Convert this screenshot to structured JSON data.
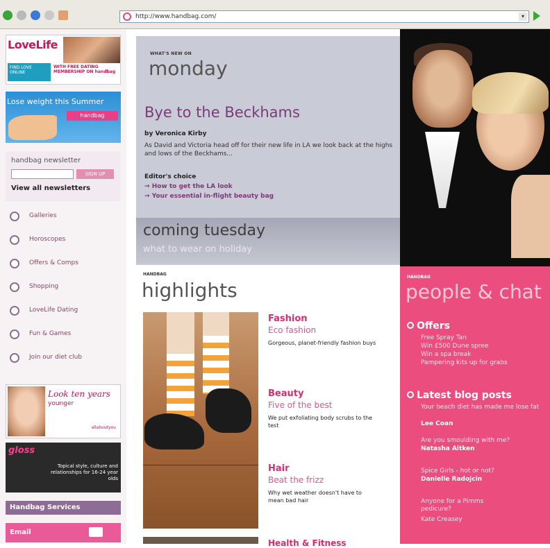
{
  "browser": {
    "address": "http://www.handbag.com/"
  },
  "sidebar": {
    "lovelife_logo": "LoveLife",
    "lovelife_left": "FIND LOVE ONLINE",
    "lovelife_right": "WITH FREE DATING MEMBERSHIP ON handbag",
    "summer_banner": "Lose weight this Summer",
    "summer_brand": "handbag",
    "newsletter_title": "handbag newsletter",
    "newsletter_button": "SIGN UP",
    "newsletter_all": "View all newsletters",
    "nav": [
      "Galleries",
      "Horoscopes",
      "Offers & Comps",
      "Shopping",
      "LoveLife Dating",
      "Fun & Games",
      "Join our diet club"
    ],
    "look_title": "Look ten years",
    "look_sub": "younger",
    "look_brand": "allaboutyou",
    "girl_title": "gloss",
    "girl_desc": "Topical style, culture and relationships for 16-24 year olds",
    "services": "Handbag Services",
    "email": "Email"
  },
  "feature": {
    "whats_new": "WHAT'S NEW ON",
    "day": "monday",
    "headline": "Bye to the Beckhams",
    "byline": "by Veronica Kirby",
    "standfirst": "As David and Victoria head off for their new life in LA we look back at the highs and lows of the Beckhams...",
    "editors_choice": "Editor's choice",
    "links": [
      "How to get the LA look",
      "Your essential in-flight beauty bag"
    ],
    "coming_title": "coming tuesday",
    "coming_sub": "what to wear on holiday"
  },
  "highlights": {
    "pre": "HANDBAG",
    "title": "highlights",
    "items": [
      {
        "title": "Fashion",
        "sub": "Eco fashion",
        "desc": "Gorgeous, planet-friendly fashion buys"
      },
      {
        "title": "Beauty",
        "sub": "Five of the best",
        "desc": "We put exfoliating body scrubs to the test"
      },
      {
        "title": "Hair",
        "sub": "Beat the frizz",
        "desc": "Why wet weather doesn't have to mean bad hair"
      }
    ],
    "next_title": "Health & Fitness"
  },
  "people_chat": {
    "pre": "HANDBAG",
    "title": "people & chat",
    "offers_title": "Offers",
    "offers": [
      "Free Spray Tan",
      "Win £500 Dune spree",
      "Win a spa break",
      "Pampering kits up for grabs"
    ],
    "blog_title": "Latest blog posts",
    "posts": [
      {
        "text": "Your beach diet has made me lose fat",
        "author": "Lee Coan"
      },
      {
        "text": "Are you smoulding with me?",
        "author": "Natasha Aitken"
      },
      {
        "text": "Spice Girls - hot or not?",
        "author": "Danielle Radojcin"
      },
      {
        "text": "Anyone for a Pimms pedicure?",
        "author": "Kate Creasey"
      }
    ]
  },
  "colors": {
    "brand_pink": "#eb4d7f",
    "feature_bg": "#c9cbd6",
    "headline_purple": "#7b3a78"
  }
}
